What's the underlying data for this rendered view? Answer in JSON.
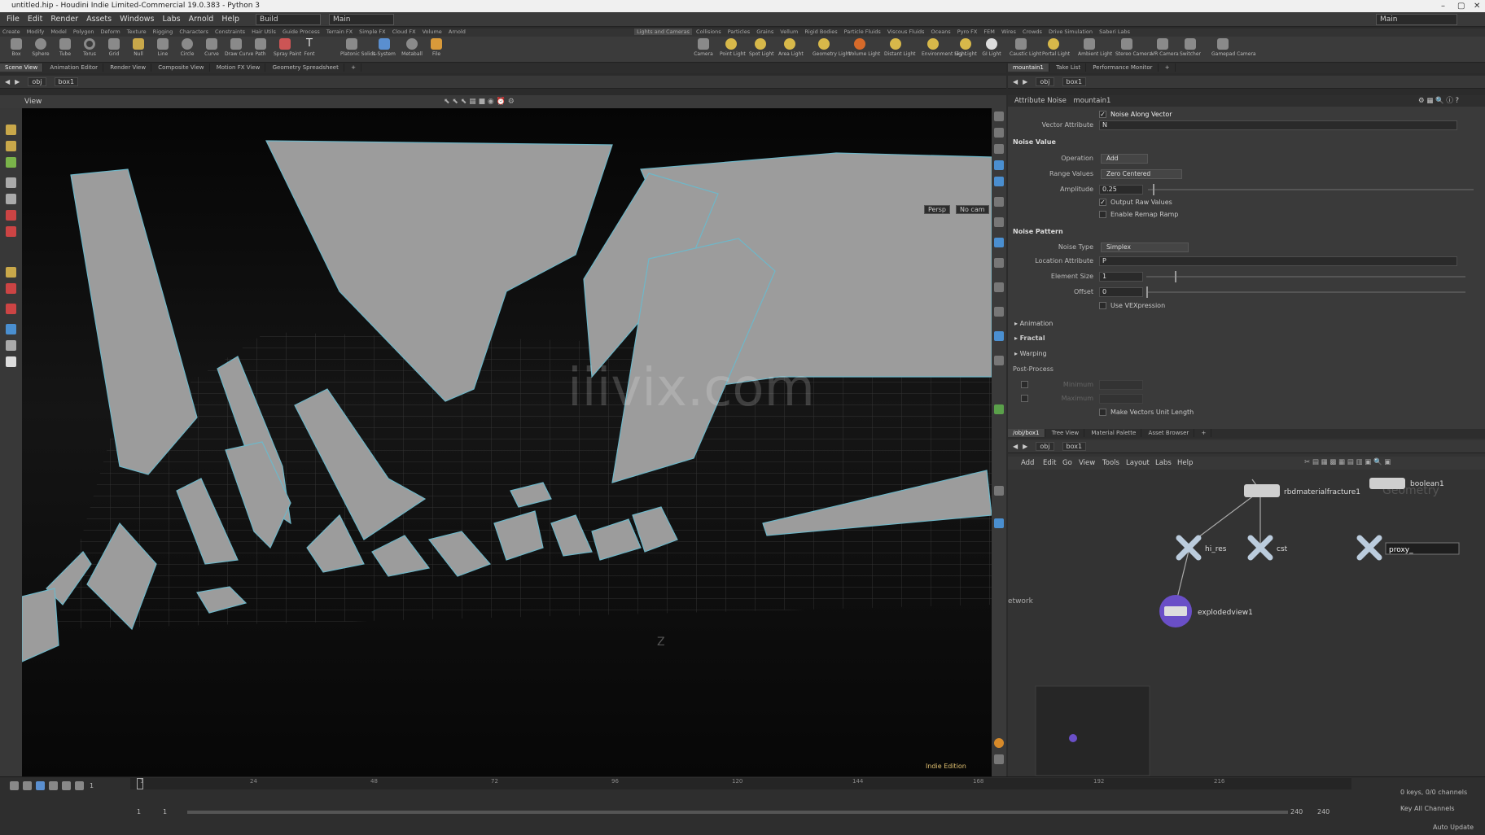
{
  "window": {
    "title": "untitled.hip - Houdini Indie Limited-Commercial 19.0.383 - Python 3"
  },
  "menu": [
    "File",
    "Edit",
    "Render",
    "Assets",
    "Windows",
    "Labs",
    "Arnold",
    "Help"
  ],
  "desktop": {
    "build": "Build",
    "main": "Main",
    "right_main": "Main"
  },
  "shelf_tabs_left": [
    "Create",
    "Modify",
    "Model",
    "Polygon",
    "Deform",
    "Texture",
    "Rigging",
    "Characters",
    "Constraints",
    "Hair Utils",
    "Guide Process",
    "Terrain FX",
    "Simple FX",
    "Cloud FX",
    "Volume",
    "Arnold"
  ],
  "shelf_tabs_right": [
    "Lights and Cameras",
    "Collisions",
    "Particles",
    "Grains",
    "Vellum",
    "Rigid Bodies",
    "Particle Fluids",
    "Viscous Fluids",
    "Oceans",
    "Pyro FX",
    "FEM",
    "Wires",
    "Crowds",
    "Drive Simulation",
    "Saberi Labs"
  ],
  "shelf_tools_left": [
    "Box",
    "Sphere",
    "Tube",
    "Torus",
    "Grid",
    "Null",
    "Line",
    "Circle",
    "Curve",
    "Draw Curve",
    "Path",
    "Spray Paint",
    "Font",
    "Platonic Solids",
    "L-System",
    "Metaball",
    "File"
  ],
  "shelf_tools_right": [
    "Camera",
    "Point Light",
    "Spot Light",
    "Area Light",
    "Geometry Light",
    "Volume Light",
    "Distant Light",
    "Environment Light",
    "Sky Light",
    "GI Light",
    "Caustic Light",
    "Portal Light",
    "Ambient Light",
    "Stereo Camera",
    "VR Camera",
    "Switcher",
    "Gamepad Camera"
  ],
  "left_pane_tabs": [
    "Scene View",
    "Animation Editor",
    "Render View",
    "Composite View",
    "Motion FX View",
    "Geometry Spreadsheet"
  ],
  "right_pane_tabs": [
    "mountain1",
    "Take List",
    "Performance Monitor"
  ],
  "path": {
    "obj": "obj",
    "node": "box1"
  },
  "viewport": {
    "label": "View",
    "persp": "Persp",
    "cam": "No cam",
    "edition": "Indie Edition",
    "watermark": "iiivix.com",
    "axis_label": "Z"
  },
  "params": {
    "node_type": "Attribute Noise",
    "node_name": "mountain1",
    "noise_along_vector": "Noise Along Vector",
    "vector_attribute_label": "Vector Attribute",
    "vector_attribute": "N",
    "noise_value_hdr": "Noise Value",
    "operation_label": "Operation",
    "operation": "Add",
    "range_values_label": "Range Values",
    "range_values": "Zero Centered",
    "amplitude_label": "Amplitude",
    "amplitude": "0.25",
    "output_raw": "Output Raw Values",
    "enable_remap": "Enable Remap Ramp",
    "noise_pattern_hdr": "Noise Pattern",
    "noise_type_label": "Noise Type",
    "noise_type": "Simplex",
    "location_attr_label": "Location Attribute",
    "location_attr": "P",
    "element_size_label": "Element Size",
    "element_size": "1",
    "offset_label": "Offset",
    "offset": "0",
    "use_vex": "Use VEXpression",
    "animation": "Animation",
    "fractal": "Fractal",
    "warping": "Warping",
    "post_process": "Post-Process",
    "minimum": "Minimum",
    "maximum": "Maximum",
    "make_unit": "Make Vectors Unit Length"
  },
  "net_tabs": [
    "/obj/box1",
    "Tree View",
    "Material Palette",
    "Asset Browser"
  ],
  "net_menu": [
    "Add",
    "Edit",
    "Go",
    "View",
    "Tools",
    "Layout",
    "Labs",
    "Help"
  ],
  "nodes": {
    "rbd": "rbdmaterialfracture1",
    "boolean": "boolean1",
    "hi_res": "hi_res",
    "cst": "cst",
    "proxy": "proxy_",
    "exploded": "explodedview1",
    "geometry_watermark": "Geometry",
    "network_label": "etwork"
  },
  "timeline": {
    "frame": "1",
    "ticks": [
      "1",
      "24",
      "48",
      "72",
      "96",
      "120",
      "144",
      "168",
      "192",
      "216"
    ],
    "start": "1",
    "start2": "1",
    "end": "240",
    "end2": "240",
    "keys": "0 keys, 0/0 channels",
    "key_all": "Key All Channels",
    "auto_update": "Auto Update"
  },
  "colors": {
    "viewport_bg": "#000000",
    "shard": "#9c9c9c",
    "edge": "#6fb7c8",
    "node_purple": "#6a4fc7"
  }
}
